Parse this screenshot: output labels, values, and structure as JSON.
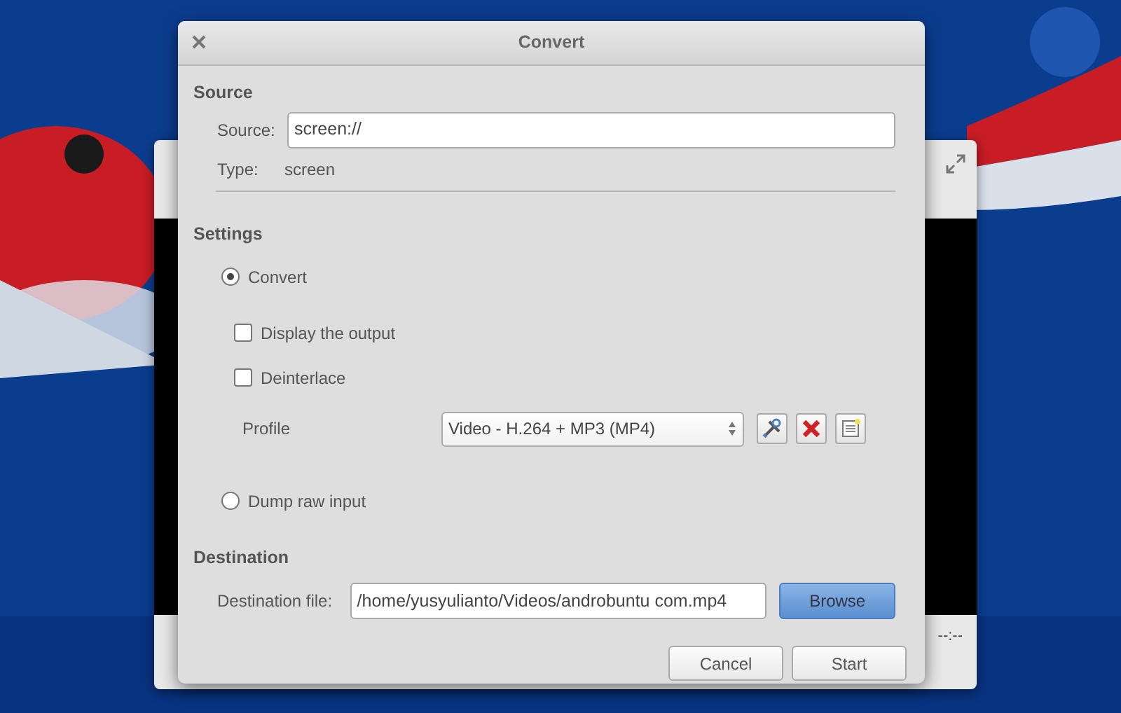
{
  "background_window": {
    "time": "--:--"
  },
  "dialog": {
    "title": "Convert",
    "source": {
      "heading": "Source",
      "label": "Source:",
      "value": "screen://",
      "type_label": "Type:",
      "type_value": "screen"
    },
    "settings": {
      "heading": "Settings",
      "modes": [
        {
          "label": "Convert",
          "selected": true
        },
        {
          "label": "Dump raw input",
          "selected": false
        }
      ],
      "options": [
        {
          "label": "Display the output",
          "checked": false
        },
        {
          "label": "Deinterlace",
          "checked": false
        }
      ],
      "profile_label": "Profile",
      "profile_value": "Video - H.264 + MP3 (MP4)"
    },
    "destination": {
      "heading": "Destination",
      "label": "Destination file:",
      "value": "/home/yusyulianto/Videos/androbuntu com.mp4",
      "browse": "Browse"
    },
    "buttons": [
      {
        "label": "Cancel",
        "kind": "normal"
      },
      {
        "label": "Start",
        "kind": "normal"
      }
    ]
  }
}
